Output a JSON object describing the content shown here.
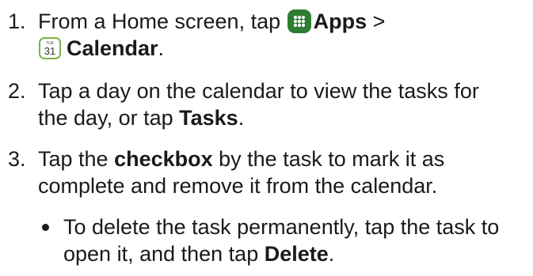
{
  "steps": [
    {
      "number": "1.",
      "line1_pre": "From a Home screen, tap ",
      "apps_label": "Apps",
      "line1_post": " >",
      "calendar_label": "Calendar",
      "line2_post": "."
    },
    {
      "number": "2.",
      "line1": "Tap a day on the calendar to view the tasks for",
      "line2_pre": "the day, or tap ",
      "tasks_label": "Tasks",
      "line2_post": "."
    },
    {
      "number": "3.",
      "line1_pre": "Tap the ",
      "checkbox_label": "checkbox",
      "line1_post": " by the task to mark it as",
      "line2": "complete and remove it from the calendar."
    }
  ],
  "bullet": {
    "line1": "To delete the task permanently, tap the task to",
    "line2_pre": "open it, and then tap ",
    "delete_label": "Delete",
    "line2_post": "."
  },
  "icons": {
    "apps": "apps-grid-icon",
    "calendar": "calendar-icon",
    "calendar_day_abbr": "TUE",
    "calendar_day_num": "31"
  },
  "colors": {
    "text": "#1a1a1a",
    "apps_icon_bg": "#2e7d32",
    "calendar_icon_border": "#7cb342"
  }
}
